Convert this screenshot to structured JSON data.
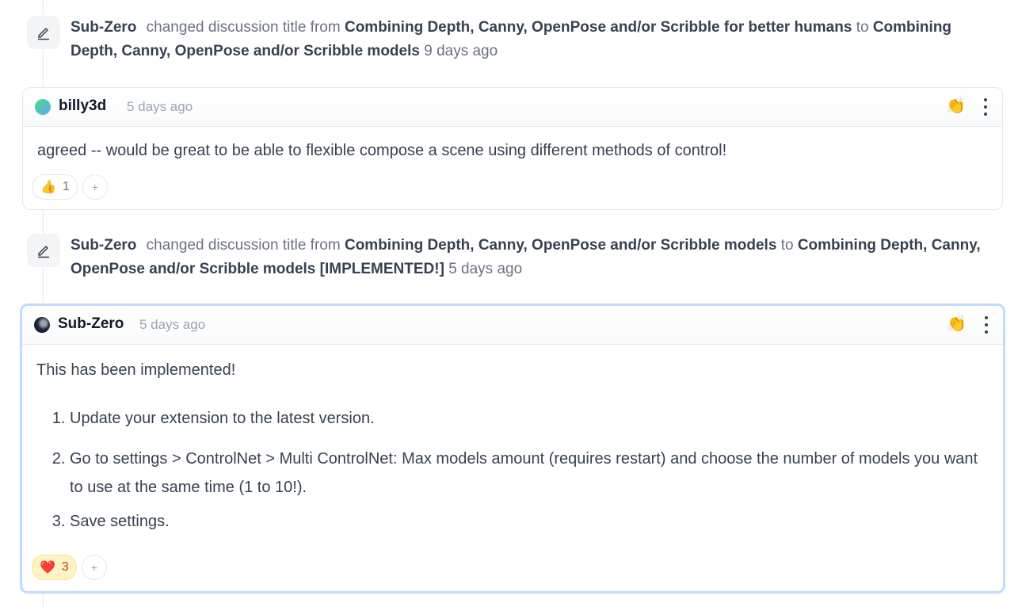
{
  "events": [
    {
      "user": "Sub-Zero",
      "action": "changed discussion title from",
      "from": "Combining Depth, Canny, OpenPose and/or Scribble for better humans",
      "connector": "to",
      "to": "Combining Depth, Canny, OpenPose and/or Scribble models",
      "time": "9 days ago",
      "icon": "pencil-icon"
    },
    {
      "user": "Sub-Zero",
      "action": "changed discussion title from",
      "from": "Combining Depth, Canny, OpenPose and/or Scribble models",
      "connector": "to",
      "to": "Combining Depth, Canny, OpenPose and/or Scribble models [IMPLEMENTED!]",
      "time": "5 days ago",
      "icon": "pencil-icon"
    }
  ],
  "comments": [
    {
      "author": "billy3d",
      "time": "5 days ago",
      "body": "agreed -- would be great to be able to flexible compose a scene using different methods of control!",
      "reaction": {
        "emoji": "👍",
        "count": "1"
      },
      "add_reaction": "+"
    },
    {
      "author": "Sub-Zero",
      "time": "5 days ago",
      "intro": "This has been implemented!",
      "steps": [
        "Update your extension to the latest version.",
        "Go to settings > ControlNet > Multi ControlNet: Max models amount (requires restart) and choose the number of models you want to use at the same time (1 to 10!).",
        "Save settings."
      ],
      "reaction": {
        "emoji": "❤️",
        "count": "3"
      },
      "add_reaction": "+"
    }
  ],
  "header_emoji": "👏"
}
